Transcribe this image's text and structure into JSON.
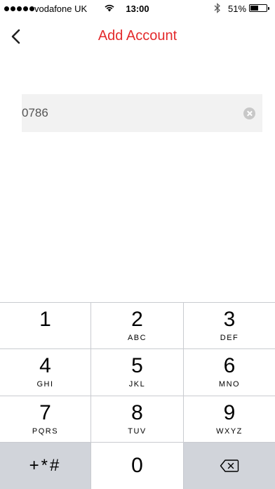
{
  "status": {
    "carrier": "vodafone UK",
    "time": "13:00",
    "battery": "51%",
    "battery_level": 0.51
  },
  "nav": {
    "title": "Add Account",
    "accent": "#e32a2c"
  },
  "field": {
    "value": "0786"
  },
  "keypad": {
    "keys": [
      {
        "digit": "1",
        "letters": ""
      },
      {
        "digit": "2",
        "letters": "ABC"
      },
      {
        "digit": "3",
        "letters": "DEF"
      },
      {
        "digit": "4",
        "letters": "GHI"
      },
      {
        "digit": "5",
        "letters": "JKL"
      },
      {
        "digit": "6",
        "letters": "MNO"
      },
      {
        "digit": "7",
        "letters": "PQRS"
      },
      {
        "digit": "8",
        "letters": "TUV"
      },
      {
        "digit": "9",
        "letters": "WXYZ"
      }
    ],
    "symbols": "+*#",
    "zero": "0"
  }
}
